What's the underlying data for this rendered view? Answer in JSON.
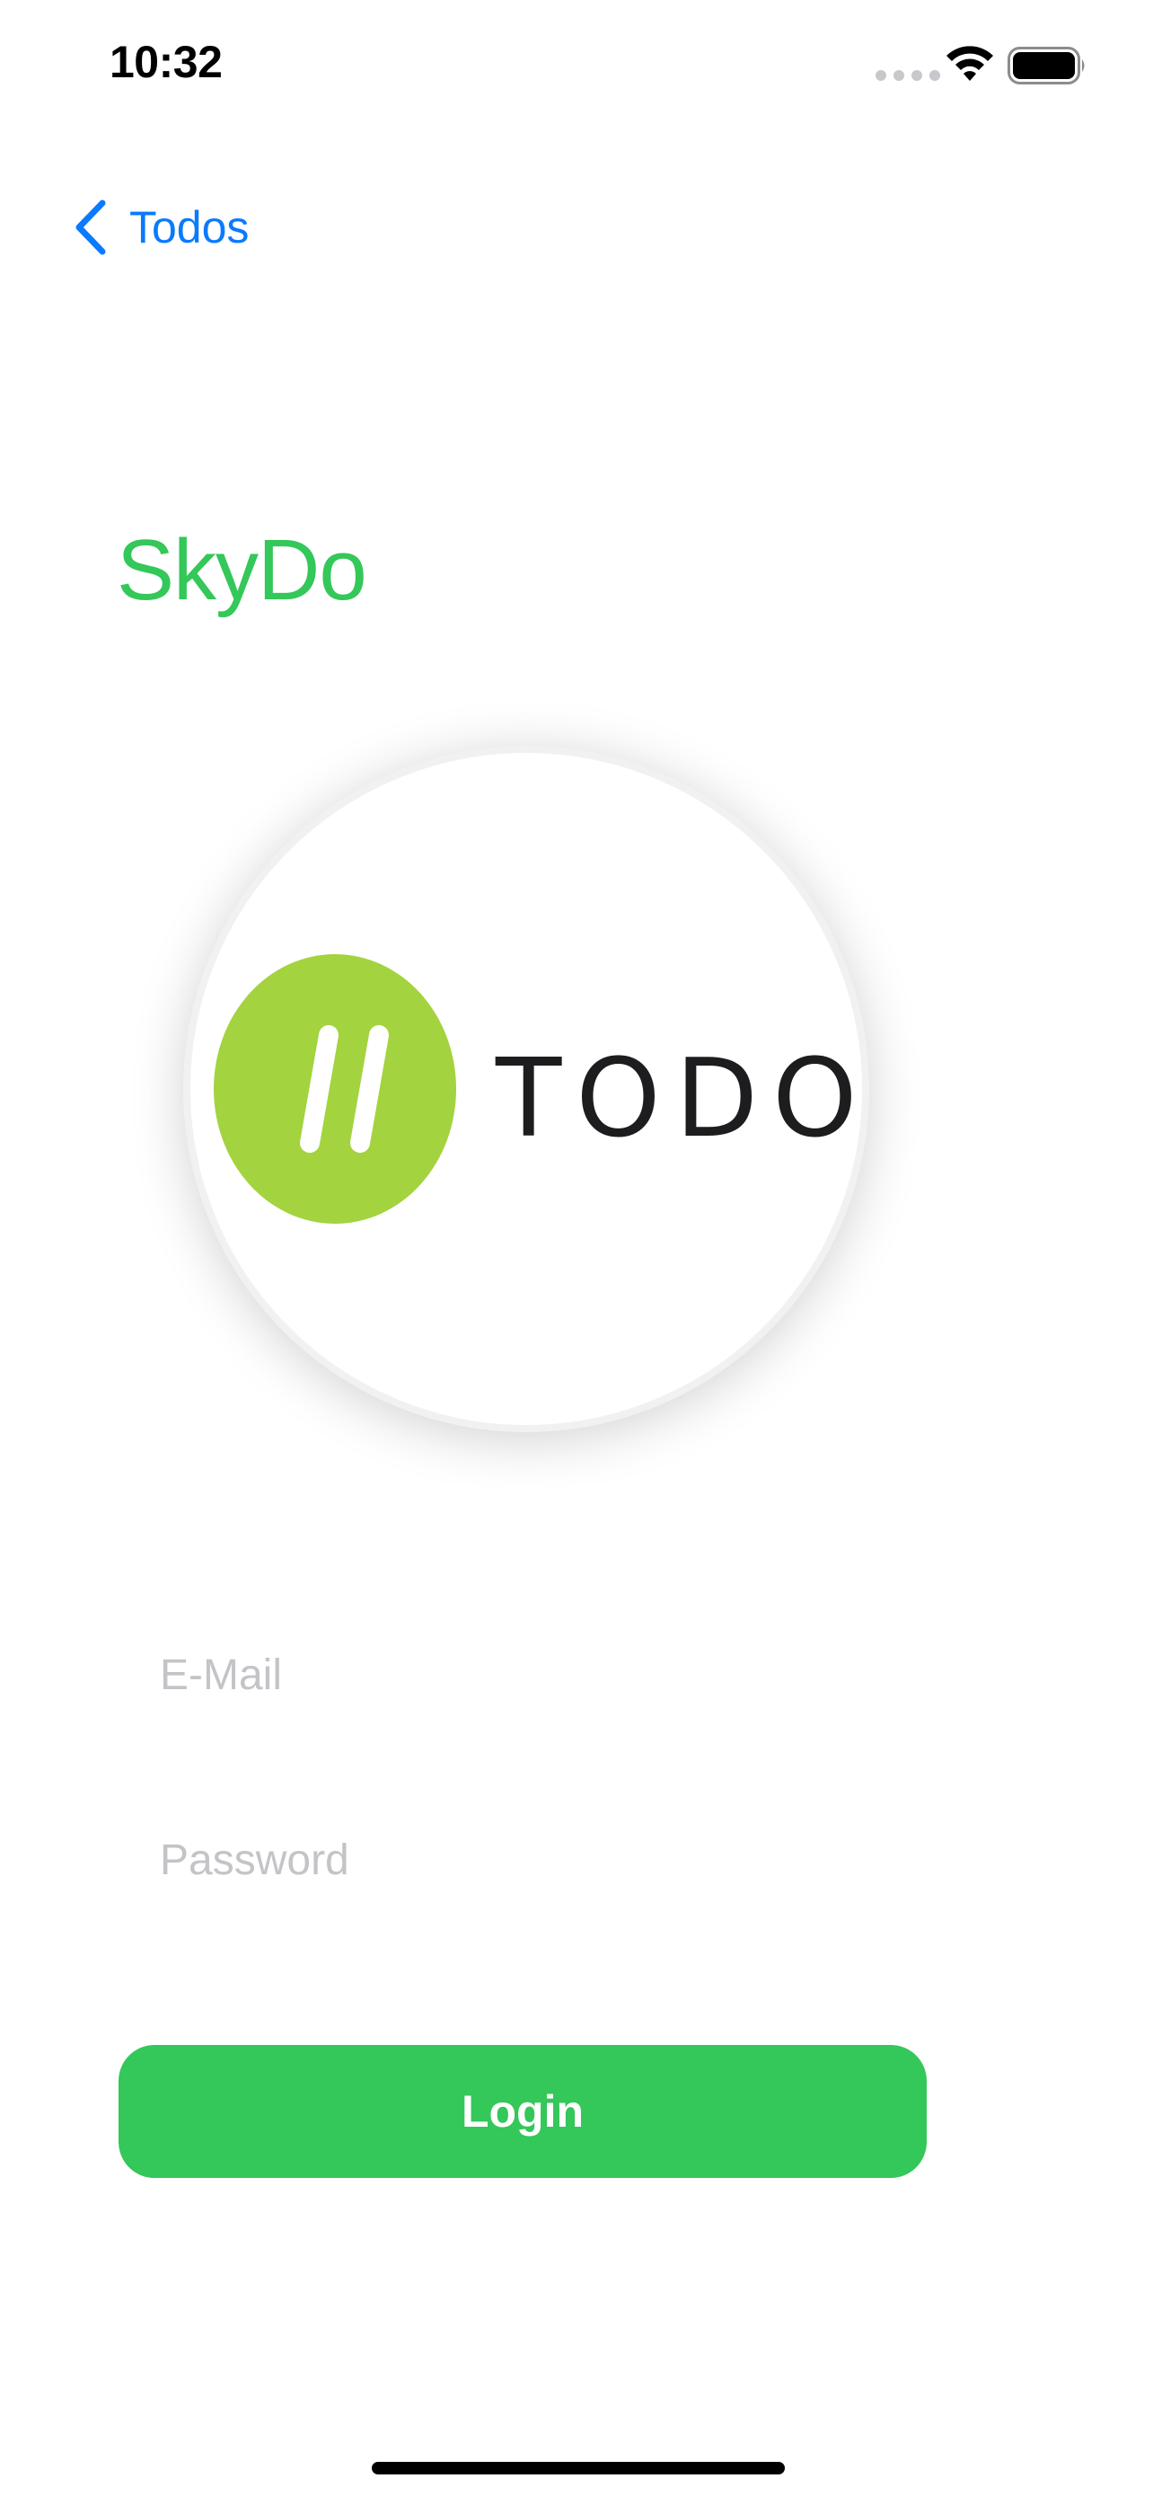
{
  "status_bar": {
    "time": "10:32",
    "icons": [
      "cellular-signal-icon",
      "wifi-icon",
      "battery-icon"
    ]
  },
  "nav": {
    "back_label": "Todos",
    "back_icon": "chevron-left-icon"
  },
  "app_title": "SkyDo",
  "logo": {
    "text": "TODO",
    "mark_color": "#a3d33f"
  },
  "form": {
    "email_placeholder": "E-Mail",
    "email_value": "",
    "password_placeholder": "Password",
    "password_value": "",
    "login_label": "Login"
  },
  "colors": {
    "accent_green": "#34c759",
    "link_blue": "#0a7aff",
    "placeholder_gray": "#c4c4c8"
  }
}
